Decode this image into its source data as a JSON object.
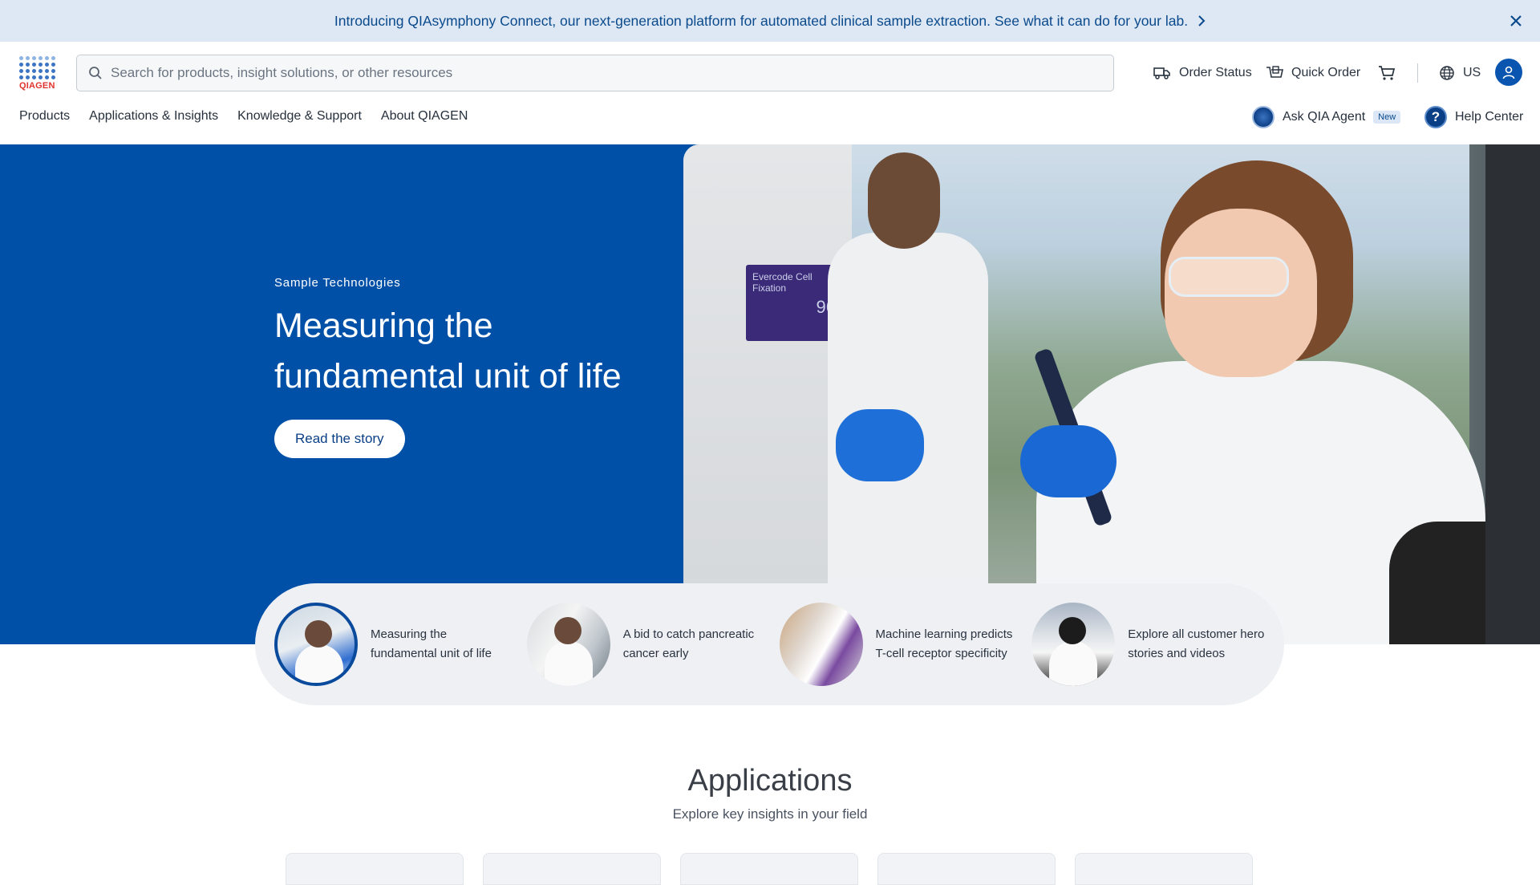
{
  "announcement": {
    "text": "Introducing QIAsymphony Connect, our next-generation platform for automated clinical sample extraction. See what it can do for your lab.",
    "icons": {
      "chevron": "chevron-right-icon",
      "close": "close-icon"
    }
  },
  "brand": {
    "logo_text": "QIAGEN",
    "primary": "#0050a8",
    "accent": "#e0332d"
  },
  "search": {
    "placeholder": "Search for products, insight solutions, or other resources"
  },
  "utility": {
    "order_status": "Order Status",
    "quick_order": "Quick Order",
    "region": "US"
  },
  "nav": {
    "items": [
      "Products",
      "Applications & Insights",
      "Knowledge & Support",
      "About QIAGEN"
    ],
    "agent_label": "Ask QIA Agent",
    "agent_badge": "New",
    "help_label": "Help Center"
  },
  "hero": {
    "eyebrow": "Sample Technologies",
    "headline": "Measuring the fundamental unit of life",
    "cta": "Read the story",
    "photo_label": "Evercode Cell Fixation",
    "photo_number": "96"
  },
  "stories": [
    {
      "label": "Measuring the fundamental unit of life",
      "active": true
    },
    {
      "label": "A bid to catch pancreatic cancer early",
      "active": false
    },
    {
      "label": "Machine learning predicts T-cell receptor specificity",
      "active": false
    },
    {
      "label": "Explore all customer hero stories and videos",
      "active": false
    }
  ],
  "applications": {
    "title": "Applications",
    "subtitle": "Explore key insights in your field"
  }
}
